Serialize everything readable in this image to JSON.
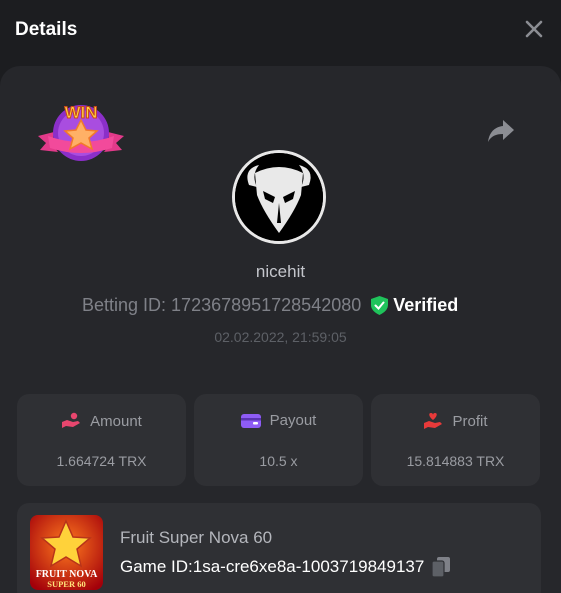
{
  "header": {
    "title": "Details"
  },
  "badge": {
    "text": "WIN"
  },
  "user": {
    "name": "nicehit",
    "betting_id_label": "Betting ID:",
    "betting_id": "1723678951728542080",
    "verified_label": "Verified",
    "datetime": "02.02.2022, 21:59:05"
  },
  "stats": {
    "amount": {
      "label": "Amount",
      "value": "1.664724 TRX"
    },
    "payout": {
      "label": "Payout",
      "value": "10.5 x"
    },
    "profit": {
      "label": "Profit",
      "value": "15.814883 TRX"
    }
  },
  "game": {
    "name": "Fruit Super Nova 60",
    "id_label": "Game ID:",
    "id": "1sa-cre6xe8a-1003719849137",
    "thumb_line1": "FRUIT NOVA",
    "thumb_line2": "SUPER 60"
  },
  "colors": {
    "background": "#1c1d20",
    "panel": "#26272b",
    "card": "#2f3034",
    "verified_green": "#1fc35b",
    "amount_icon": "#e8466e",
    "payout_icon": "#8e5cf5",
    "profit_icon": "#e83a3a"
  },
  "icons": {
    "close": "close-icon",
    "share": "share-icon",
    "verified": "shield-check-icon",
    "amount": "hand-coin-icon",
    "payout": "wallet-icon",
    "profit": "hand-heart-icon",
    "copy": "copy-icon"
  }
}
